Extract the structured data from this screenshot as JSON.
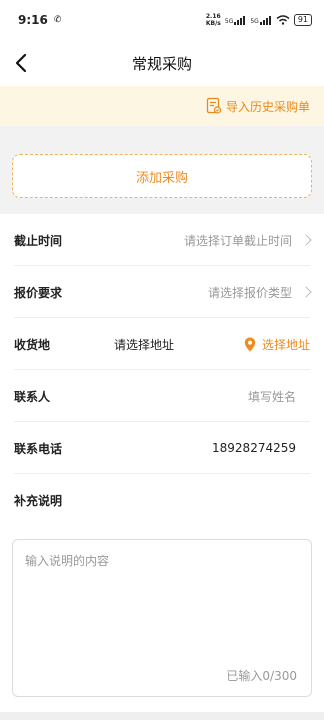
{
  "status": {
    "time": "9:16",
    "network_speed_top": "2.16",
    "network_speed_bottom": "KB/s",
    "signal1": "5G",
    "signal2": "5G",
    "battery": "91"
  },
  "nav": {
    "title": "常规采购"
  },
  "import": {
    "label": "导入历史采购单"
  },
  "add": {
    "label": "添加采购"
  },
  "form": {
    "deadline": {
      "label": "截止时间",
      "placeholder": "请选择订单截止时间"
    },
    "quote": {
      "label": "报价要求",
      "placeholder": "请选择报价类型"
    },
    "address": {
      "label": "收货地",
      "placeholder": "请选择地址",
      "action": "选择地址"
    },
    "contact": {
      "label": "联系人",
      "placeholder": "填写姓名"
    },
    "phone": {
      "label": "联系电话",
      "value": "18928274259"
    },
    "notes": {
      "label": "补充说明",
      "placeholder": "输入说明的内容",
      "counter": "已输入0/300"
    }
  },
  "colors": {
    "accent": "#ef8c1f",
    "import_bg": "#fdf6e2"
  }
}
